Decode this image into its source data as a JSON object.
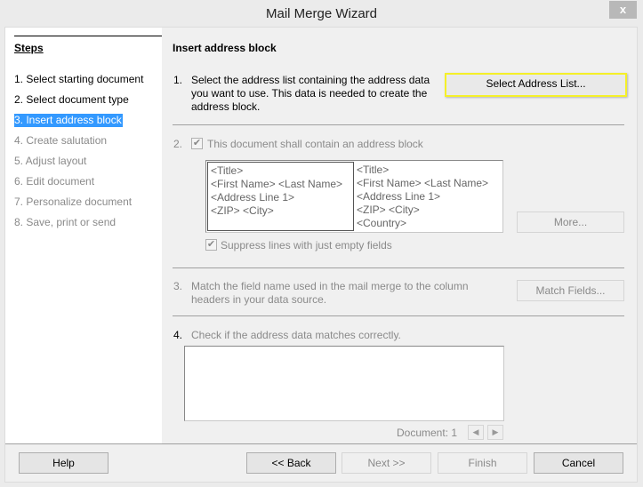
{
  "window": {
    "title": "Mail Merge Wizard",
    "close_label": "x"
  },
  "sidebar": {
    "title": "Steps",
    "items": [
      {
        "label": "1. Select starting document",
        "state": "enabled"
      },
      {
        "label": "2. Select document type",
        "state": "enabled"
      },
      {
        "label": "3. Insert address block",
        "state": "active"
      },
      {
        "label": "4. Create salutation",
        "state": "disabled"
      },
      {
        "label": "5. Adjust layout",
        "state": "disabled"
      },
      {
        "label": "6. Edit document",
        "state": "disabled"
      },
      {
        "label": "7. Personalize document",
        "state": "disabled"
      },
      {
        "label": "8. Save, print or send",
        "state": "disabled"
      }
    ]
  },
  "main": {
    "title": "Insert address block",
    "step1": {
      "number": "1.",
      "text": "Select the address list containing the address data you want to use. This data is needed to create the address block.",
      "button_label": "Select Address List..."
    },
    "step2": {
      "number": "2.",
      "checkbox_label": "This document shall contain an address block",
      "checked": true,
      "address_blocks": [
        [
          "<Title>",
          "<First Name>  <Last Name>",
          "<Address Line 1>",
          "<ZIP>  <City>"
        ],
        [
          "<Title>",
          "<First Name>  <Last Name>",
          "<Address Line 1>",
          "<ZIP>  <City>",
          "<Country>"
        ]
      ],
      "more_button_label": "More...",
      "suppress_label": "Suppress lines with just empty fields",
      "suppress_checked": true
    },
    "step3": {
      "number": "3.",
      "text": "Match the field name used in the mail merge to the column headers in your data source.",
      "button_label": "Match Fields..."
    },
    "step4": {
      "number": "4.",
      "text": "Check if the address data matches correctly.",
      "document_label": "Document: 1",
      "prev_icon": "◀",
      "next_icon": "▶"
    }
  },
  "footer": {
    "help_label": "Help",
    "back_label": "<< Back",
    "next_label": "Next >>",
    "finish_label": "Finish",
    "cancel_label": "Cancel"
  },
  "colors": {
    "active_step": "#3399ff",
    "highlight_border": "#f5f028"
  }
}
